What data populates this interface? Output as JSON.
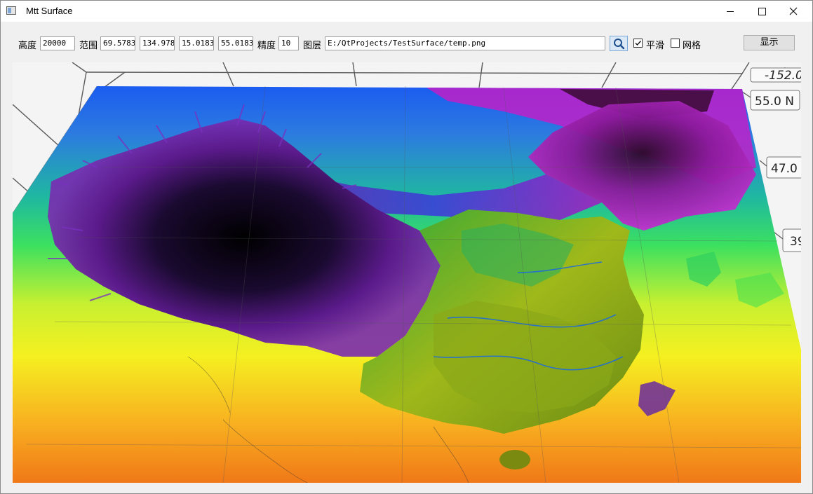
{
  "window": {
    "title": "Mtt Surface"
  },
  "toolbar": {
    "height_label": "高度",
    "height_value": "20000",
    "range_label": "范围",
    "range_values": [
      "69.5783",
      "134.978",
      "15.0183",
      "55.0183"
    ],
    "precision_label": "精度",
    "precision_value": "10",
    "layer_label": "图层",
    "layer_path": "E:/QtProjects/TestSurface/temp.png",
    "smooth_label": "平滑",
    "smooth_checked": true,
    "grid_label": "网格",
    "grid_checked": false,
    "show_button": "显示"
  },
  "plot": {
    "lat_labels": [
      "55.0 N",
      "47.0",
      "39"
    ],
    "lon_label": "-152.0"
  }
}
